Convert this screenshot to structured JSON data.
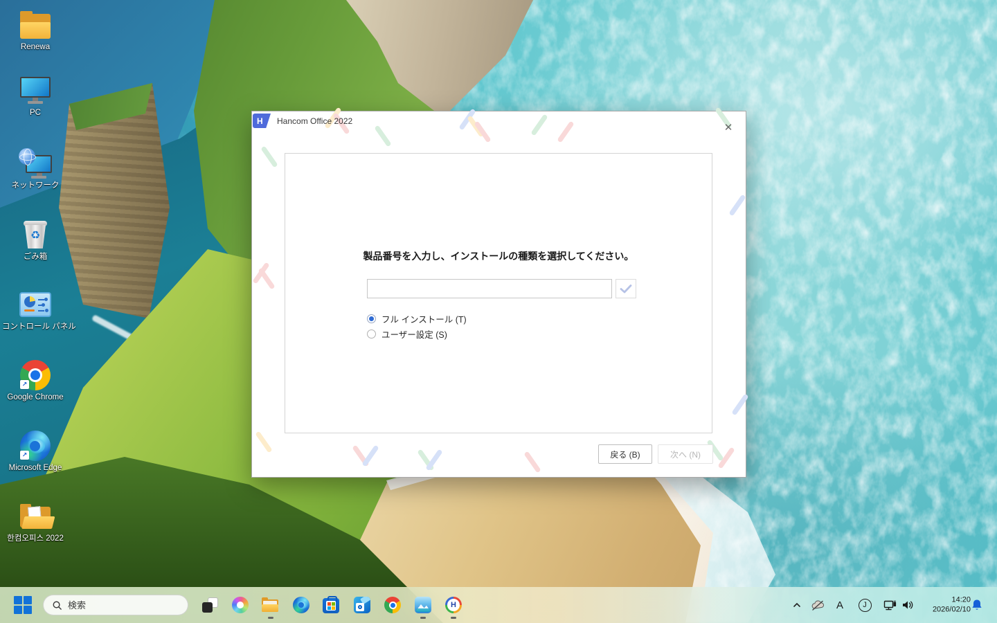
{
  "colors": {
    "accent_blue": "#2e6bd4",
    "dialog_logo_blue": "#4f6bdb",
    "bell_blue": "#1660d8",
    "pattern_green": "#d7eedd",
    "pattern_pink": "#f9d9d9",
    "pattern_blue": "#d6e1f8",
    "pattern_yellow": "#fdeccb"
  },
  "desktop": {
    "icons": [
      {
        "label": "Renewa"
      },
      {
        "label": "PC"
      },
      {
        "label": "ネットワーク"
      },
      {
        "label": "ごみ箱"
      },
      {
        "label": "コントロール パネル"
      },
      {
        "label": "Google Chrome"
      },
      {
        "label": "Microsoft Edge"
      },
      {
        "label": "한컴오피스 2022"
      }
    ]
  },
  "dialog": {
    "title": "Hancom Office 2022",
    "logo_letter": "H",
    "close_glyph": "✕",
    "heading": "製品番号を入力し、インストールの種類を選択してください。",
    "product_number_value": "",
    "radios": [
      {
        "label": "フル インストール (T)",
        "selected": true
      },
      {
        "label": "ユーザー設定 (S)",
        "selected": false
      }
    ],
    "back_button": "戻る (B)",
    "next_button": "次へ (N)"
  },
  "taskbar": {
    "search_placeholder": "検索",
    "hancom_letter": "H",
    "tray": {
      "ime_indicator": "A",
      "journal_letter": "J",
      "time": "14:20",
      "date": "2026/02/10"
    }
  },
  "icons_glyphs": {
    "recycle": "♻",
    "shortcut_arrow": "↗"
  }
}
